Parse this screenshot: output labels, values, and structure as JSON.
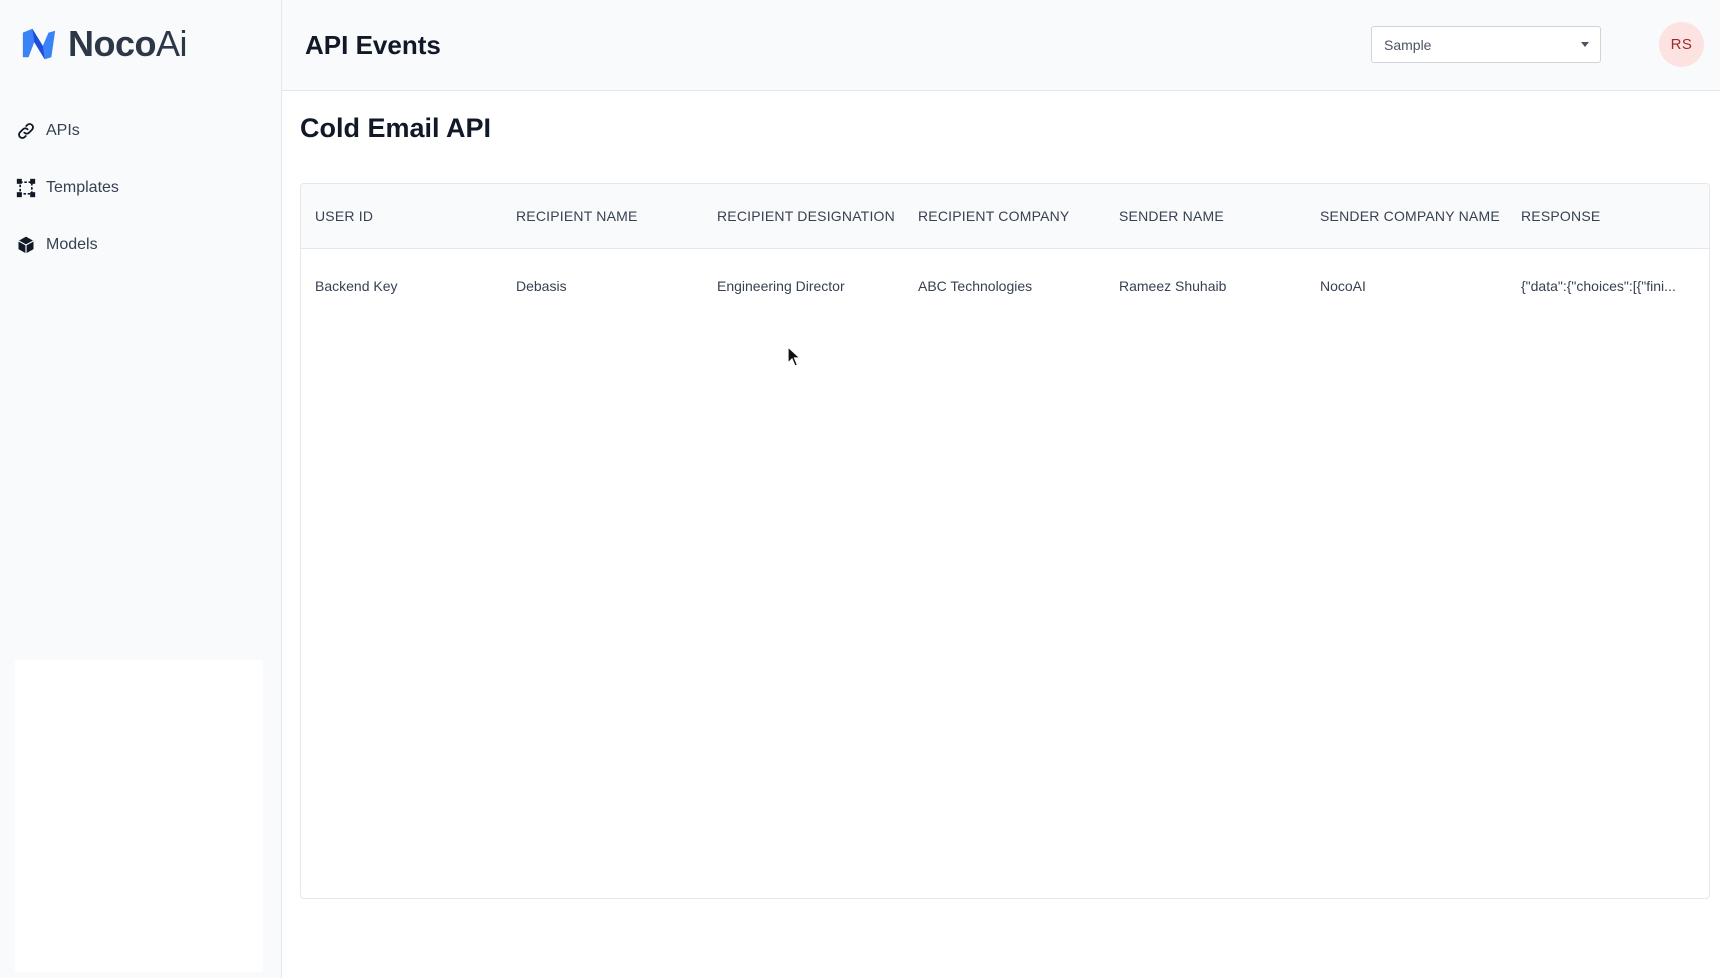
{
  "brand": {
    "name_bold": "Noco",
    "name_light": "Ai",
    "colors": {
      "primary": "#3b82f6",
      "secondary": "#1d4ed8"
    }
  },
  "sidebar": {
    "items": [
      {
        "label": "APIs",
        "icon": "link-icon"
      },
      {
        "label": "Templates",
        "icon": "frame-icon"
      },
      {
        "label": "Models",
        "icon": "cube-icon"
      }
    ]
  },
  "header": {
    "title": "API Events",
    "select": {
      "value": "Sample"
    },
    "avatar": {
      "initials": "RS"
    }
  },
  "main": {
    "section_title": "Cold Email API",
    "table": {
      "columns": [
        "USER ID",
        "RECIPIENT NAME",
        "RECIPIENT DESIGNATION",
        "RECIPIENT COMPANY",
        "SENDER NAME",
        "SENDER COMPANY NAME",
        "RESPONSE"
      ],
      "rows": [
        [
          "Backend Key",
          "Debasis",
          "Engineering Director",
          "ABC Technologies",
          "Rameez Shuhaib",
          "NocoAI",
          "{\"data\":{\"choices\":[{\"fini..."
        ]
      ]
    }
  }
}
